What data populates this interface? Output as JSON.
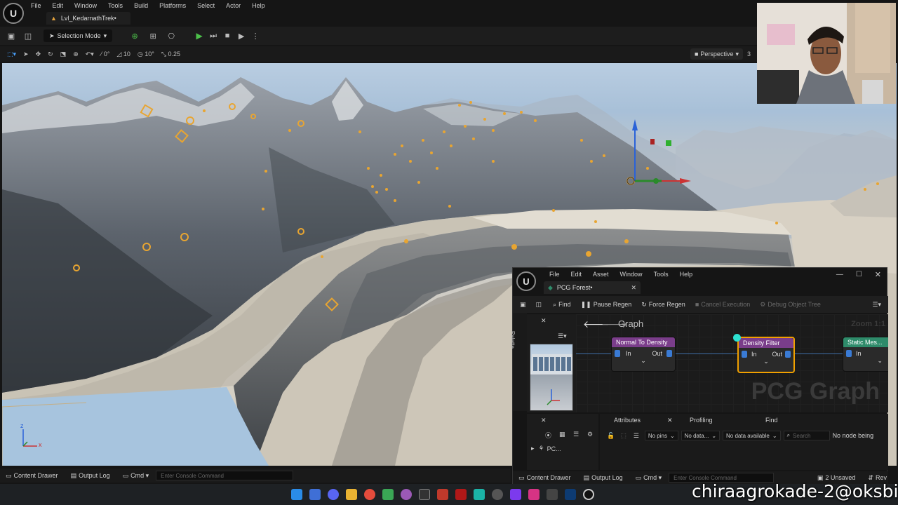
{
  "app": {
    "menu": [
      "File",
      "Edit",
      "Window",
      "Tools",
      "Build",
      "Platforms",
      "Select",
      "Actor",
      "Help"
    ],
    "level_tab": "Lvl_KedarnathTrek•",
    "logo": "U"
  },
  "toolbar": {
    "selection_mode": "Selection Mode"
  },
  "viewport_toolbar": {
    "grid_snap": "0°",
    "move_snap": "10",
    "rotate_snap": "10°",
    "scale_snap": "0.25",
    "view_mode": "Perspective",
    "extra": "3"
  },
  "axis": {
    "z": "z",
    "x": "x"
  },
  "bottombar": {
    "content_drawer": "Content Drawer",
    "output_log": "Output Log",
    "cmd": "Cmd",
    "console_placeholder": "Enter Console Command"
  },
  "pcg_window": {
    "menu": [
      "File",
      "Edit",
      "Asset",
      "Window",
      "Tools",
      "Help"
    ],
    "tab": "PCG Forest•",
    "toolbar": {
      "find": "Find",
      "pause_regen": "Pause Regen",
      "force_regen": "Force Regen",
      "cancel_execution": "Cancel Execution",
      "debug_object_tree": "Debug Object Tree"
    },
    "palette": "Palette",
    "graph": {
      "title": "Graph",
      "zoom": "Zoom 1:1",
      "watermark": "PCG Graph",
      "nodes": [
        {
          "title": "Normal To Density",
          "in": "In",
          "out": "Out",
          "color": "#7a3d8a"
        },
        {
          "title": "Density Filter",
          "in": "In",
          "out": "Out",
          "color": "#7a3d8a"
        },
        {
          "title": "Static Mes...",
          "in": "In",
          "color": "#2e8b6a"
        }
      ]
    },
    "details": {
      "item": "PC..."
    },
    "attributes": {
      "tab_attributes": "Attributes",
      "tab_profiling": "Profiling",
      "tab_find": "Find",
      "pins": "No pins",
      "data": "No data...",
      "available": "No data available",
      "search_placeholder": "Search",
      "status": "No node being"
    },
    "bottombar": {
      "content_drawer": "Content Drawer",
      "output_log": "Output Log",
      "cmd": "Cmd",
      "console_placeholder": "Enter Console Command",
      "unsaved": "2 Unsaved",
      "rev": "Rev"
    }
  },
  "watermark": "chiraagrokade-2@oksbi",
  "colors": {
    "accent_orange": "#e8a531",
    "play_green": "#4cc04a",
    "node_purple": "#7a3d8a",
    "node_green": "#2e8b6a",
    "selection_orange": "#f0a000"
  }
}
